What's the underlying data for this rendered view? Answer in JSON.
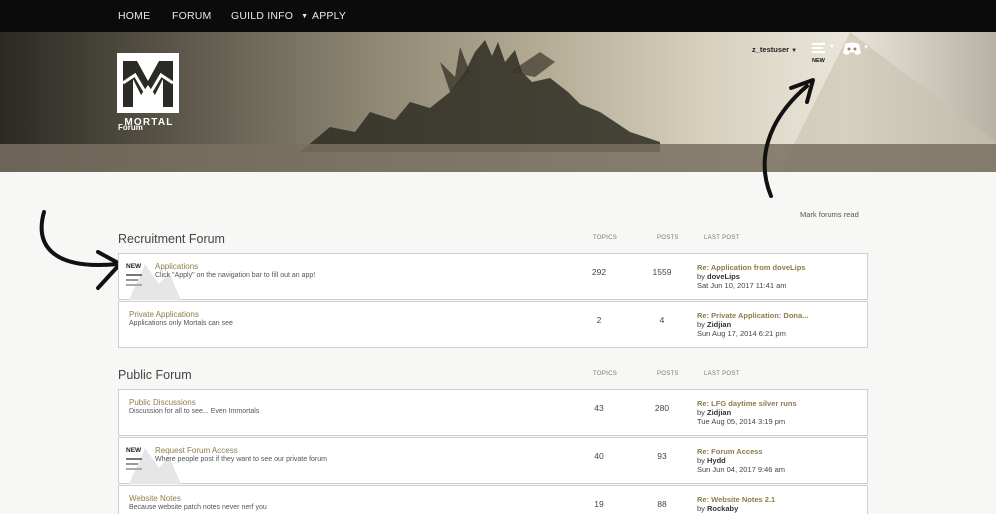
{
  "nav": {
    "items": [
      {
        "label": "HOME"
      },
      {
        "label": "FORUM"
      },
      {
        "label": "GUILD INFO"
      },
      {
        "label": "APPLY"
      }
    ]
  },
  "header": {
    "logo_text": "MORTAL",
    "username": "z_testuser",
    "notification_new": "NEW",
    "breadcrumb": "Forum"
  },
  "mark_read": "Mark forums read",
  "columns": {
    "topics": "TOPICS",
    "posts": "POSTS",
    "last_post": "LAST POST"
  },
  "sections": [
    {
      "title": "Recruitment Forum",
      "forums": [
        {
          "title": "Applications",
          "desc": "Click \"Apply\" on the navigation bar to fill out an app!",
          "topics": "292",
          "posts": "1559",
          "lp_title": "Re: Application from doveLips",
          "lp_by_prefix": "by",
          "lp_by": "doveLips",
          "lp_date": "Sat Jun 10, 2017 11:41 am",
          "new": "NEW"
        },
        {
          "title": "Private Applications",
          "desc": "Applications only Mortals can see",
          "topics": "2",
          "posts": "4",
          "lp_title": "Re: Private Application: Dona...",
          "lp_by_prefix": "by",
          "lp_by": "Zidjian",
          "lp_date": "Sun Aug 17, 2014 6:21 pm"
        }
      ]
    },
    {
      "title": "Public Forum",
      "forums": [
        {
          "title": "Public Discussions",
          "desc": "Discussion for all to see... Even Immortals",
          "topics": "43",
          "posts": "280",
          "lp_title": "Re: LFG daytime silver runs",
          "lp_by_prefix": "by",
          "lp_by": "Zidjian",
          "lp_date": "Tue Aug 05, 2014 3:19 pm"
        },
        {
          "title": "Request Forum Access",
          "desc": "Where people post if they want to see our private forum",
          "topics": "40",
          "posts": "93",
          "lp_title": "Re: Forum Access",
          "lp_by_prefix": "by",
          "lp_by": "Hydd",
          "lp_date": "Sun Jun 04, 2017 9:46 am",
          "new": "NEW"
        },
        {
          "title": "Website Notes",
          "desc": "Because website patch notes never nerf you",
          "topics": "19",
          "posts": "88",
          "lp_title": "Re: Website Notes 2.1",
          "lp_by_prefix": "by",
          "lp_by": "Rockaby",
          "lp_date": ""
        }
      ]
    }
  ]
}
